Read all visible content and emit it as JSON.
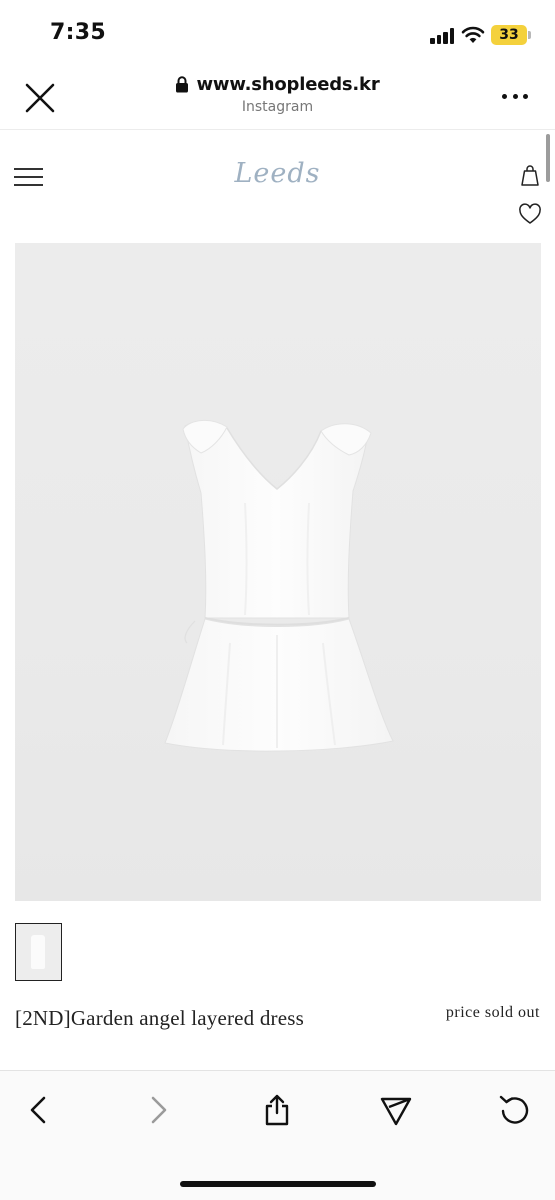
{
  "status_bar": {
    "time": "7:35",
    "battery": "33",
    "battery_color": "#f4d13c"
  },
  "browser": {
    "url": "www.shopleeds.kr",
    "source": "Instagram",
    "icons": [
      "close-icon",
      "lock-icon",
      "more-icon"
    ]
  },
  "site": {
    "logo": "Leeds",
    "logo_color": "#9fb1c2",
    "icons": [
      "hamburger-menu-icon",
      "shopping-bag-icon",
      "heart-icon"
    ]
  },
  "product": {
    "name": "[2ND]Garden angel layered dress",
    "price_status": "price sold out",
    "image_background": "#ececec"
  },
  "toolbar": {
    "icons": [
      "back-icon",
      "forward-icon",
      "share-icon",
      "send-icon",
      "reload-icon"
    ]
  }
}
